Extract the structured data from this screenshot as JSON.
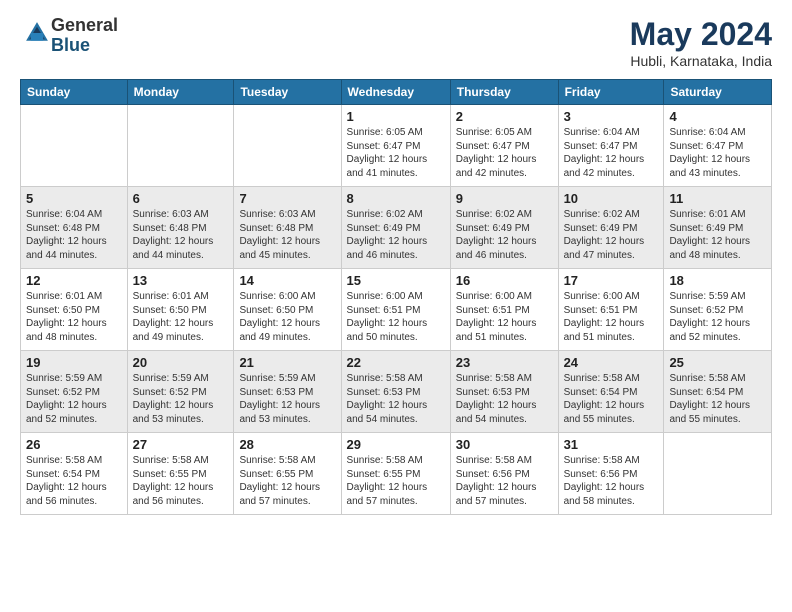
{
  "header": {
    "logo_line1": "General",
    "logo_line2": "Blue",
    "month_title": "May 2024",
    "location": "Hubli, Karnataka, India"
  },
  "weekdays": [
    "Sunday",
    "Monday",
    "Tuesday",
    "Wednesday",
    "Thursday",
    "Friday",
    "Saturday"
  ],
  "weeks": [
    [
      {
        "day": "",
        "info": ""
      },
      {
        "day": "",
        "info": ""
      },
      {
        "day": "",
        "info": ""
      },
      {
        "day": "1",
        "info": "Sunrise: 6:05 AM\nSunset: 6:47 PM\nDaylight: 12 hours\nand 41 minutes."
      },
      {
        "day": "2",
        "info": "Sunrise: 6:05 AM\nSunset: 6:47 PM\nDaylight: 12 hours\nand 42 minutes."
      },
      {
        "day": "3",
        "info": "Sunrise: 6:04 AM\nSunset: 6:47 PM\nDaylight: 12 hours\nand 42 minutes."
      },
      {
        "day": "4",
        "info": "Sunrise: 6:04 AM\nSunset: 6:47 PM\nDaylight: 12 hours\nand 43 minutes."
      }
    ],
    [
      {
        "day": "5",
        "info": "Sunrise: 6:04 AM\nSunset: 6:48 PM\nDaylight: 12 hours\nand 44 minutes."
      },
      {
        "day": "6",
        "info": "Sunrise: 6:03 AM\nSunset: 6:48 PM\nDaylight: 12 hours\nand 44 minutes."
      },
      {
        "day": "7",
        "info": "Sunrise: 6:03 AM\nSunset: 6:48 PM\nDaylight: 12 hours\nand 45 minutes."
      },
      {
        "day": "8",
        "info": "Sunrise: 6:02 AM\nSunset: 6:49 PM\nDaylight: 12 hours\nand 46 minutes."
      },
      {
        "day": "9",
        "info": "Sunrise: 6:02 AM\nSunset: 6:49 PM\nDaylight: 12 hours\nand 46 minutes."
      },
      {
        "day": "10",
        "info": "Sunrise: 6:02 AM\nSunset: 6:49 PM\nDaylight: 12 hours\nand 47 minutes."
      },
      {
        "day": "11",
        "info": "Sunrise: 6:01 AM\nSunset: 6:49 PM\nDaylight: 12 hours\nand 48 minutes."
      }
    ],
    [
      {
        "day": "12",
        "info": "Sunrise: 6:01 AM\nSunset: 6:50 PM\nDaylight: 12 hours\nand 48 minutes."
      },
      {
        "day": "13",
        "info": "Sunrise: 6:01 AM\nSunset: 6:50 PM\nDaylight: 12 hours\nand 49 minutes."
      },
      {
        "day": "14",
        "info": "Sunrise: 6:00 AM\nSunset: 6:50 PM\nDaylight: 12 hours\nand 49 minutes."
      },
      {
        "day": "15",
        "info": "Sunrise: 6:00 AM\nSunset: 6:51 PM\nDaylight: 12 hours\nand 50 minutes."
      },
      {
        "day": "16",
        "info": "Sunrise: 6:00 AM\nSunset: 6:51 PM\nDaylight: 12 hours\nand 51 minutes."
      },
      {
        "day": "17",
        "info": "Sunrise: 6:00 AM\nSunset: 6:51 PM\nDaylight: 12 hours\nand 51 minutes."
      },
      {
        "day": "18",
        "info": "Sunrise: 5:59 AM\nSunset: 6:52 PM\nDaylight: 12 hours\nand 52 minutes."
      }
    ],
    [
      {
        "day": "19",
        "info": "Sunrise: 5:59 AM\nSunset: 6:52 PM\nDaylight: 12 hours\nand 52 minutes."
      },
      {
        "day": "20",
        "info": "Sunrise: 5:59 AM\nSunset: 6:52 PM\nDaylight: 12 hours\nand 53 minutes."
      },
      {
        "day": "21",
        "info": "Sunrise: 5:59 AM\nSunset: 6:53 PM\nDaylight: 12 hours\nand 53 minutes."
      },
      {
        "day": "22",
        "info": "Sunrise: 5:58 AM\nSunset: 6:53 PM\nDaylight: 12 hours\nand 54 minutes."
      },
      {
        "day": "23",
        "info": "Sunrise: 5:58 AM\nSunset: 6:53 PM\nDaylight: 12 hours\nand 54 minutes."
      },
      {
        "day": "24",
        "info": "Sunrise: 5:58 AM\nSunset: 6:54 PM\nDaylight: 12 hours\nand 55 minutes."
      },
      {
        "day": "25",
        "info": "Sunrise: 5:58 AM\nSunset: 6:54 PM\nDaylight: 12 hours\nand 55 minutes."
      }
    ],
    [
      {
        "day": "26",
        "info": "Sunrise: 5:58 AM\nSunset: 6:54 PM\nDaylight: 12 hours\nand 56 minutes."
      },
      {
        "day": "27",
        "info": "Sunrise: 5:58 AM\nSunset: 6:55 PM\nDaylight: 12 hours\nand 56 minutes."
      },
      {
        "day": "28",
        "info": "Sunrise: 5:58 AM\nSunset: 6:55 PM\nDaylight: 12 hours\nand 57 minutes."
      },
      {
        "day": "29",
        "info": "Sunrise: 5:58 AM\nSunset: 6:55 PM\nDaylight: 12 hours\nand 57 minutes."
      },
      {
        "day": "30",
        "info": "Sunrise: 5:58 AM\nSunset: 6:56 PM\nDaylight: 12 hours\nand 57 minutes."
      },
      {
        "day": "31",
        "info": "Sunrise: 5:58 AM\nSunset: 6:56 PM\nDaylight: 12 hours\nand 58 minutes."
      },
      {
        "day": "",
        "info": ""
      }
    ]
  ]
}
